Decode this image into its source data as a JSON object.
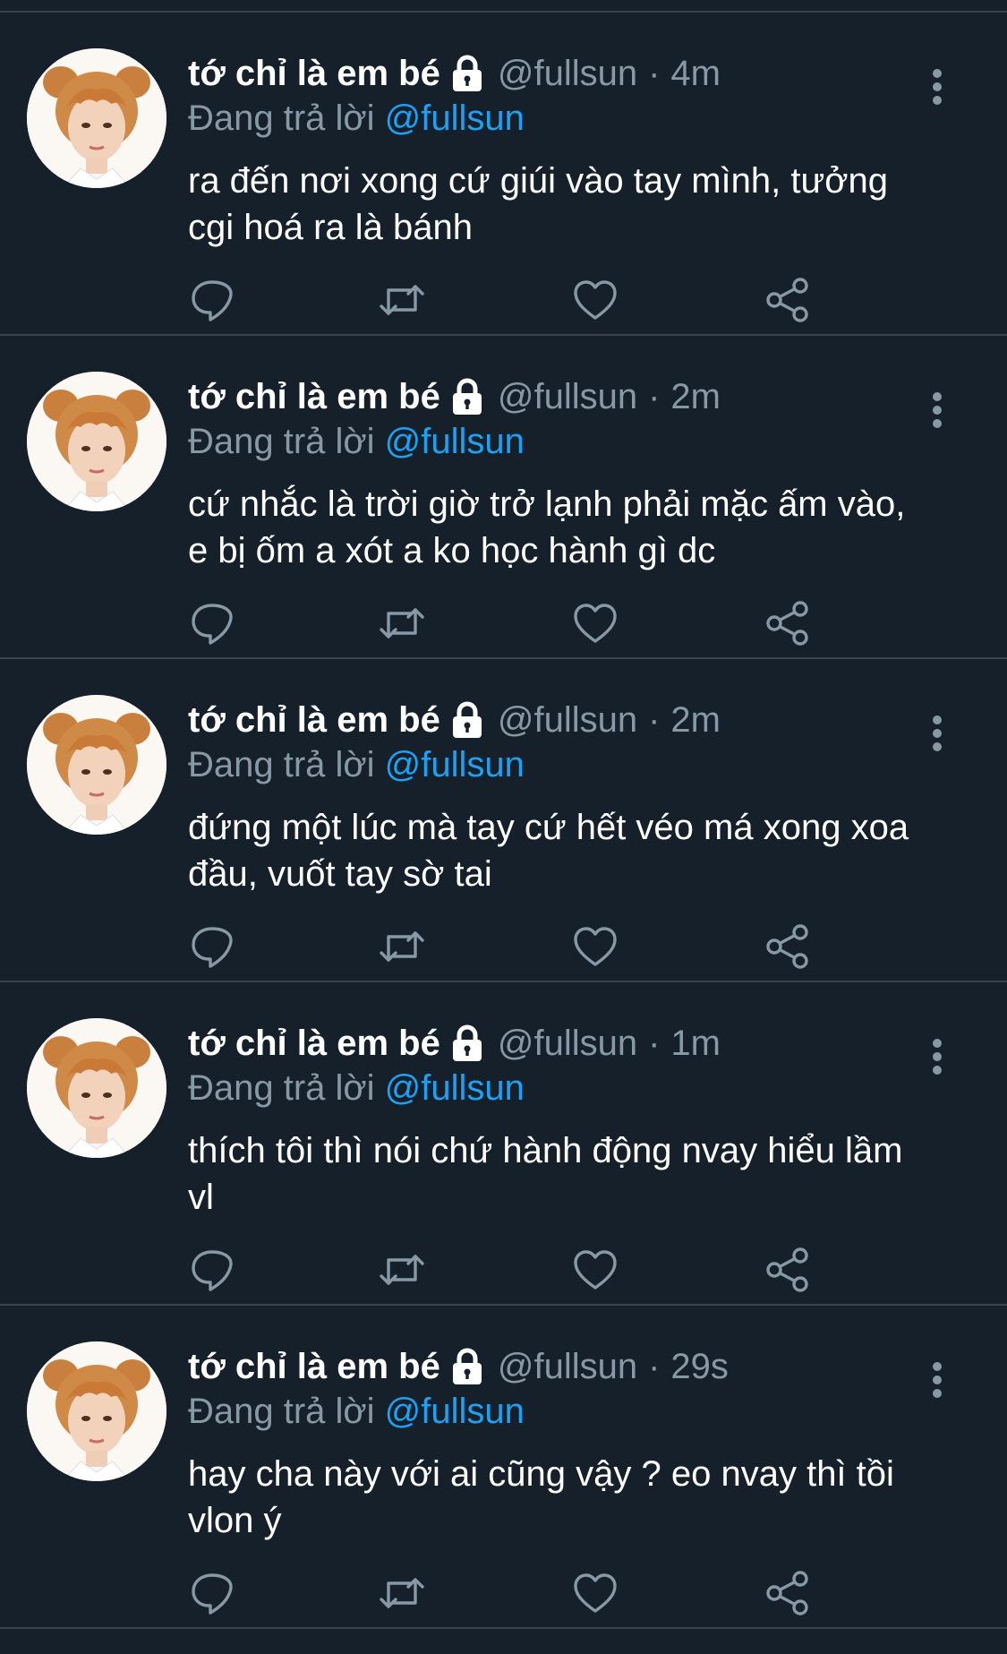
{
  "colors": {
    "background": "#15202b",
    "divider": "#38444d",
    "secondary_text": "#8899a6",
    "mention": "#1da1f2",
    "primary_text": "#ffffff"
  },
  "tweets": [
    {
      "name": "tớ chỉ là em bé",
      "handle": "@fullsun",
      "dot": "·",
      "time": "4m",
      "reply_prefix": "Đang trả lời",
      "reply_to": "@fullsun",
      "text": "ra đến nơi xong cứ giúi vào tay mình, tưởng cgi hoá ra là bánh",
      "icons": [
        "lock-icon",
        "more-vertical-icon",
        "reply-icon",
        "retweet-icon",
        "like-icon",
        "share-icon"
      ]
    },
    {
      "name": "tớ chỉ là em bé",
      "handle": "@fullsun",
      "dot": "·",
      "time": "2m",
      "reply_prefix": "Đang trả lời",
      "reply_to": "@fullsun",
      "text": "cứ nhắc là trời giờ trở lạnh phải mặc ấm vào, e bị ốm a xót a ko học hành gì dc",
      "icons": [
        "lock-icon",
        "more-vertical-icon",
        "reply-icon",
        "retweet-icon",
        "like-icon",
        "share-icon"
      ]
    },
    {
      "name": "tớ chỉ là em bé",
      "handle": "@fullsun",
      "dot": "·",
      "time": "2m",
      "reply_prefix": "Đang trả lời",
      "reply_to": "@fullsun",
      "text": "đứng một lúc mà tay cứ hết véo má xong xoa đầu, vuốt tay sờ tai",
      "icons": [
        "lock-icon",
        "more-vertical-icon",
        "reply-icon",
        "retweet-icon",
        "like-icon",
        "share-icon"
      ]
    },
    {
      "name": "tớ chỉ là em bé",
      "handle": "@fullsun",
      "dot": "·",
      "time": "1m",
      "reply_prefix": "Đang trả lời",
      "reply_to": "@fullsun",
      "text": "thích tôi thì nói chứ hành động nvay hiểu lầm vl",
      "icons": [
        "lock-icon",
        "more-vertical-icon",
        "reply-icon",
        "retweet-icon",
        "like-icon",
        "share-icon"
      ]
    },
    {
      "name": "tớ chỉ là em bé",
      "handle": "@fullsun",
      "dot": "·",
      "time": "29s",
      "reply_prefix": "Đang trả lời",
      "reply_to": "@fullsun",
      "text": "hay cha này với ai cũng vậy ? eo nvay thì tồi vlon ý",
      "icons": [
        "lock-icon",
        "more-vertical-icon",
        "reply-icon",
        "retweet-icon",
        "like-icon",
        "share-icon"
      ]
    }
  ]
}
